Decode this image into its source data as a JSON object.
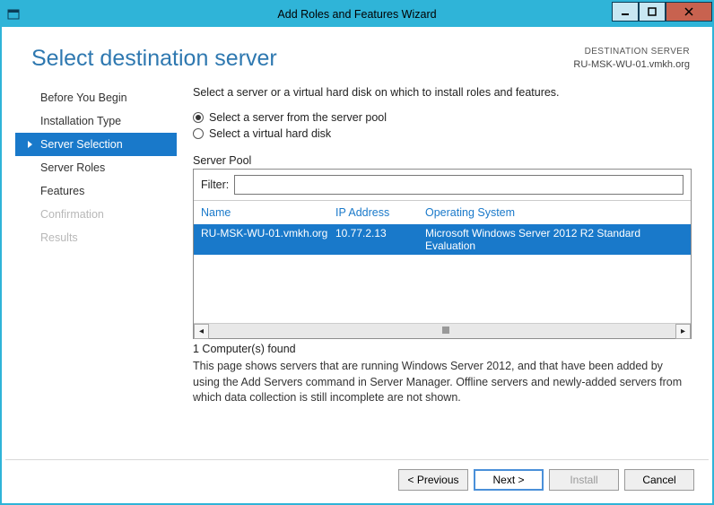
{
  "window": {
    "title": "Add Roles and Features Wizard"
  },
  "header": {
    "page_title": "Select destination server",
    "dest_label": "DESTINATION SERVER",
    "dest_value": "RU-MSK-WU-01.vmkh.org"
  },
  "sidebar": {
    "items": [
      {
        "label": "Before You Begin",
        "state": "normal"
      },
      {
        "label": "Installation Type",
        "state": "normal"
      },
      {
        "label": "Server Selection",
        "state": "active"
      },
      {
        "label": "Server Roles",
        "state": "normal"
      },
      {
        "label": "Features",
        "state": "normal"
      },
      {
        "label": "Confirmation",
        "state": "disabled"
      },
      {
        "label": "Results",
        "state": "disabled"
      }
    ]
  },
  "pane": {
    "intro": "Select a server or a virtual hard disk on which to install roles and features.",
    "radio1": "Select a server from the server pool",
    "radio2": "Select a virtual hard disk",
    "pool_label": "Server Pool",
    "filter_label": "Filter:",
    "filter_value": "",
    "columns": {
      "name": "Name",
      "ip": "IP Address",
      "os": "Operating System"
    },
    "rows": [
      {
        "name": "RU-MSK-WU-01.vmkh.org",
        "ip": "10.77.2.13",
        "os": "Microsoft Windows Server 2012 R2 Standard Evaluation"
      }
    ],
    "count_text": "1 Computer(s) found",
    "hint": "This page shows servers that are running Windows Server 2012, and that have been added by using the Add Servers command in Server Manager. Offline servers and newly-added servers from which data collection is still incomplete are not shown."
  },
  "buttons": {
    "previous": "< Previous",
    "next": "Next >",
    "install": "Install",
    "cancel": "Cancel"
  }
}
